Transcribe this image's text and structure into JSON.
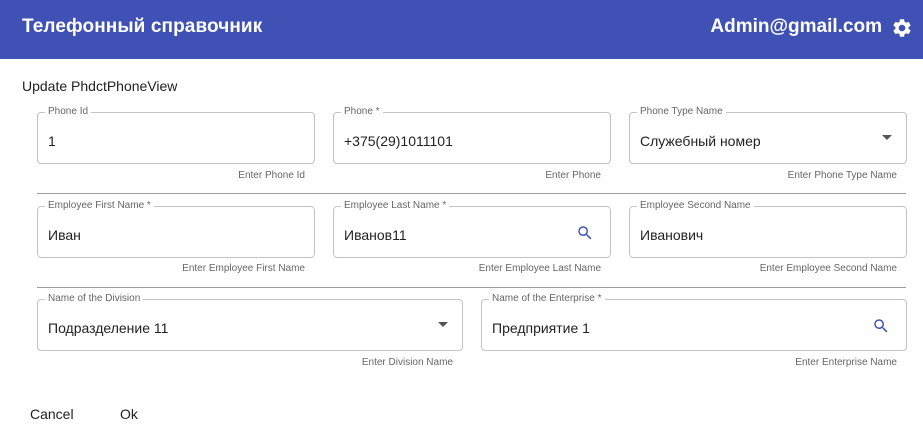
{
  "header": {
    "title": "Телефонный справочник",
    "user_email": "Admin@gmail.com",
    "settings_icon": "gear-icon",
    "background": "#3f51b5"
  },
  "form": {
    "title": "Update PhdctPhoneView",
    "fields": {
      "phone_id": {
        "label": "Phone Id",
        "value": "1",
        "helper": "Enter Phone Id"
      },
      "phone": {
        "label": "Phone *",
        "value": "+375(29)1011101",
        "helper": "Enter Phone"
      },
      "phone_type": {
        "label": "Phone Type Name",
        "value": "Служебный номер",
        "helper": "Enter Phone Type Name"
      },
      "first_name": {
        "label": "Employee First Name *",
        "value": "Иван",
        "helper": "Enter Employee First Name"
      },
      "last_name": {
        "label": "Employee Last Name *",
        "value": "Иванов11",
        "helper": "Enter Employee Last Name"
      },
      "second_name": {
        "label": "Employee Second Name",
        "value": "Иванович",
        "helper": "Enter Employee Second Name"
      },
      "division": {
        "label": "Name of the Division",
        "value": "Подразделение 11",
        "helper": "Enter Division Name"
      },
      "enterprise": {
        "label": "Name of the Enterprise *",
        "value": "Предприятие 1",
        "helper": "Enter Enterprise Name"
      }
    }
  },
  "actions": {
    "cancel_label": "Cancel",
    "ok_label": "Ok"
  }
}
